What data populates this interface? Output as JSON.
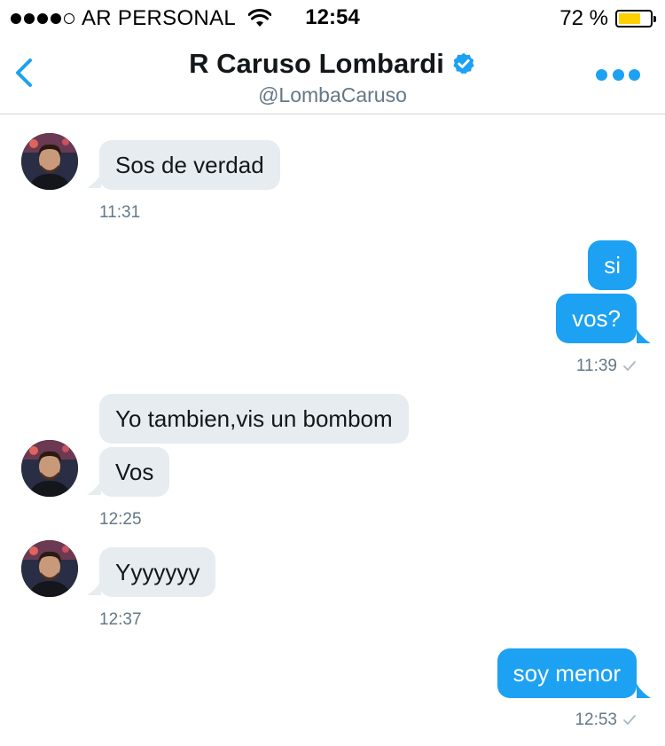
{
  "status_bar": {
    "carrier": "AR PERSONAL",
    "time": "12:54",
    "battery_percent": "72 %",
    "battery_level": 0.72,
    "signal_bars_filled": 4,
    "signal_bars_total": 5
  },
  "header": {
    "name": "R Caruso Lombardi",
    "handle": "@LombaCaruso",
    "verified": true,
    "accent_color": "#1da1f2"
  },
  "messages": [
    {
      "from": "contact",
      "text": "Sos de verdad"
    },
    {
      "from": "contact",
      "time": "11:31"
    },
    {
      "from": "me",
      "text": "si"
    },
    {
      "from": "me",
      "text": "vos?"
    },
    {
      "from": "me",
      "time": "11:39"
    },
    {
      "from": "contact",
      "text": "Yo tambien,vis un bombom"
    },
    {
      "from": "contact",
      "text": "Vos"
    },
    {
      "from": "contact",
      "time": "12:25"
    },
    {
      "from": "contact",
      "text": "Yyyyyyy"
    },
    {
      "from": "contact",
      "time": "12:37"
    },
    {
      "from": "me",
      "text": "soy menor"
    },
    {
      "from": "me",
      "time": "12:53"
    }
  ],
  "icons": [
    "back-chevron-icon",
    "verified-badge-icon",
    "more-options-icon",
    "wifi-icon",
    "read-check-icon"
  ]
}
